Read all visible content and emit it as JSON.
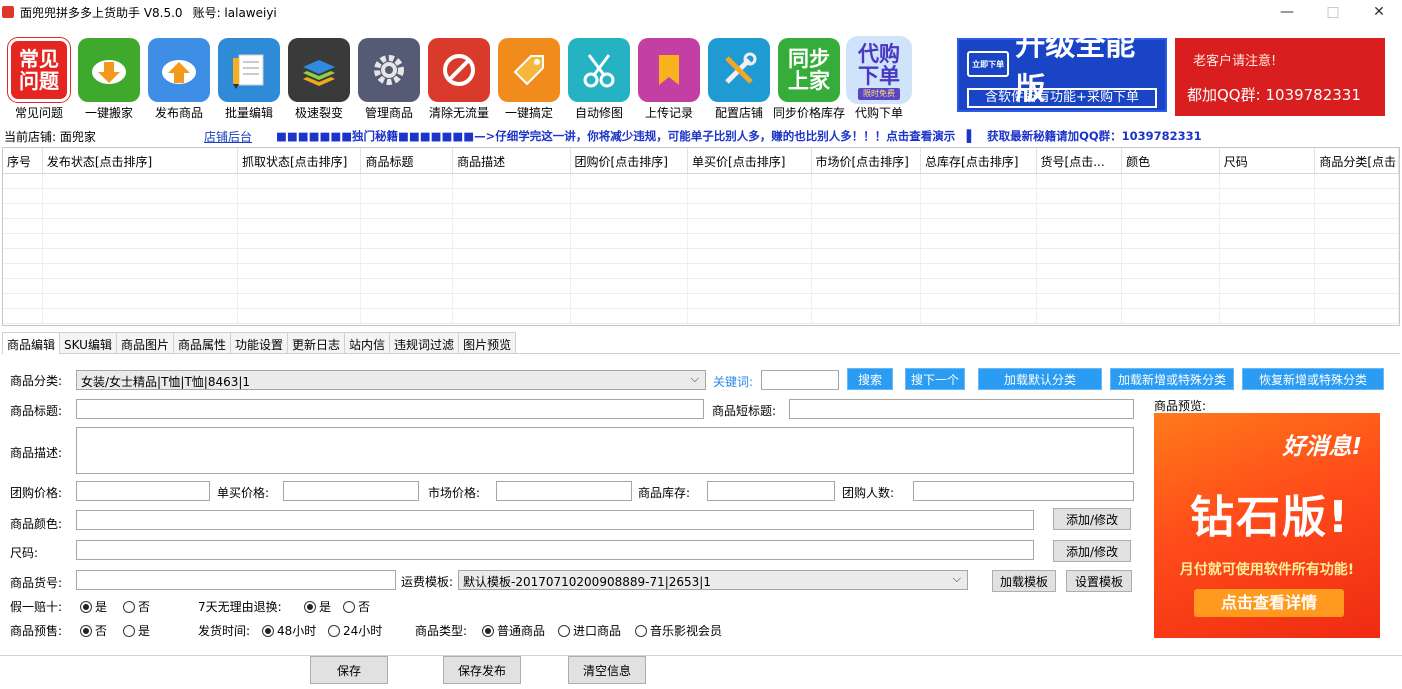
{
  "window": {
    "title": "面兜兜拼多多上货助手 V8.5.0",
    "account_label": "账号: lalaweiyi",
    "minimize": "—",
    "maximize": "□",
    "close": "✕"
  },
  "toolbar": [
    {
      "label": "常见问题",
      "tile_text": "常见\n问题",
      "color": "#e52620",
      "icon": "faq-icon"
    },
    {
      "label": "一键搬家",
      "color": "#3fa92d",
      "icon": "download-cloud-icon"
    },
    {
      "label": "发布商品",
      "color": "#3f8ee6",
      "icon": "upload-cloud-icon"
    },
    {
      "label": "批量编辑",
      "color": "#2f8bd8",
      "icon": "document-pencil-icon"
    },
    {
      "label": "极速裂变",
      "color": "#3a3a3a",
      "icon": "layers-icon"
    },
    {
      "label": "管理商品",
      "color": "#555a75",
      "icon": "gear-icon"
    },
    {
      "label": "清除无流量",
      "color": "#d93a2c",
      "icon": "no-entry-icon"
    },
    {
      "label": "一键搞定",
      "color": "#f08b1c",
      "icon": "tag-icon"
    },
    {
      "label": "自动修图",
      "color": "#25b3c4",
      "icon": "scissors-icon"
    },
    {
      "label": "上传记录",
      "color": "#c43fa4",
      "icon": "bookmark-icon"
    },
    {
      "label": "配置店铺",
      "color": "#1f9ad3",
      "icon": "tools-icon"
    },
    {
      "label": "同步价格库存",
      "tile_text": "同步\n上家",
      "color": "#36ad3a",
      "icon": "sync-text-icon"
    },
    {
      "label": "代购下单",
      "tile_text": "代购\n下单",
      "color": "#5a45c7",
      "icon": "purchase-text-icon",
      "badge": "限时免费"
    }
  ],
  "banners": {
    "upgrade": {
      "badge": "立即下单",
      "title": "升级全能版",
      "subtitle": "含软件所有功能+采购下单"
    },
    "notice": {
      "line1": "老客户请注意!",
      "line2": "都加QQ群: 1039782331"
    }
  },
  "infoline": {
    "store_label": "当前店铺: 面兜家",
    "backend_link": "店铺后台",
    "tip": "■■■■■■■独门秘籍■■■■■■■—>仔细学完这一讲，你将减少违规，可能单子比别人多，赚的也比别人多！！！点击查看演示　▌　获取最新秘籍请加QQ群：1039782331"
  },
  "grid": {
    "columns": [
      "序号",
      "发布状态[点击排序]",
      "抓取状态[点击排序]",
      "商品标题",
      "商品描述",
      "团购价[点击排序]",
      "单买价[点击排序]",
      "市场价[点击排序]",
      "总库存[点击排序]",
      "货号[点击...",
      "颜色",
      "尺码",
      "商品分类[点击"
    ]
  },
  "tabs": [
    "商品编辑",
    "SKU编辑",
    "商品图片",
    "商品属性",
    "功能设置",
    "更新日志",
    "站内信",
    "违规词过滤",
    "图片预览"
  ],
  "form": {
    "category_label": "商品分类:",
    "category_value": "女装/女士精品|T恤|T恤|8463|1",
    "keyword_label": "关键词:",
    "search_btn": "搜索",
    "search_next_btn": "搜下一个",
    "load_default_btn": "加载默认分类",
    "load_new_btn": "加载新增或特殊分类",
    "restore_btn": "恢复新增或特殊分类",
    "title_label": "商品标题:",
    "short_title_label": "商品短标题:",
    "preview_label": "商品预览:",
    "desc_label": "商品描述:",
    "group_price_label": "团购价格:",
    "single_price_label": "单买价格:",
    "market_price_label": "市场价格:",
    "stock_label": "商品库存:",
    "group_count_label": "团购人数:",
    "color_label": "商品颜色:",
    "size_label": "尺码:",
    "add_modify_btn": "添加/修改",
    "sku_label": "商品货号:",
    "shipping_label": "运费模板:",
    "shipping_value": "默认模板-20170710200908889-71|2653|1",
    "load_template_btn": "加载模板",
    "set_template_btn": "设置模板",
    "fake_label": "假一赔十:",
    "return_label": "7天无理由退换:",
    "yes": "是",
    "no": "否",
    "presale_label": "商品预售:",
    "ship_time_label": "发货时间:",
    "h48": "48小时",
    "h24": "24小时",
    "type_label": "商品类型:",
    "type_normal": "普通商品",
    "type_import": "进口商品",
    "type_music": "音乐影视会员"
  },
  "preview_ad": {
    "good_news": "好消息!",
    "title": "钻石版!",
    "monthly": "月付就可使用软件所有功能!",
    "cta": "点击查看详情"
  },
  "bottom": {
    "save": "保存",
    "save_publish": "保存发布",
    "clear": "清空信息"
  }
}
